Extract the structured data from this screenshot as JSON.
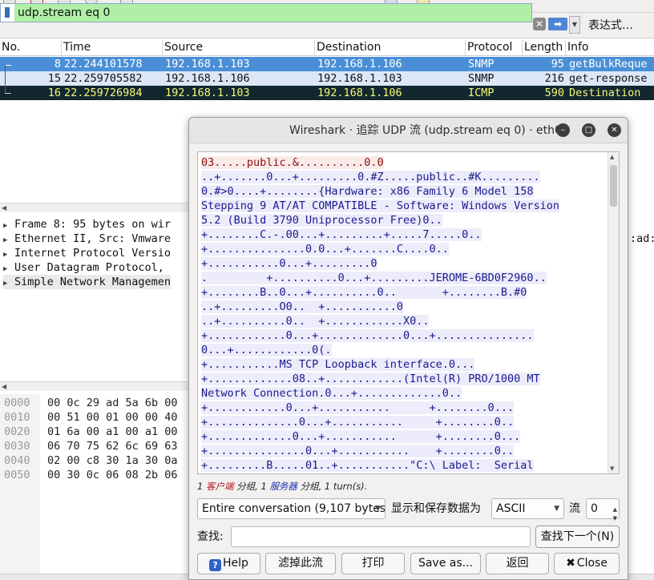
{
  "filter": {
    "value": "udp.stream eq 0",
    "expression_label": "表达式…"
  },
  "packet_list": {
    "columns": [
      "No.",
      "Time",
      "Source",
      "Destination",
      "Protocol",
      "Length",
      "Info"
    ],
    "rows": [
      {
        "no": "8",
        "time": "22.244101578",
        "source": "192.168.1.103",
        "destination": "192.168.1.106",
        "protocol": "SNMP",
        "length": "95",
        "info": "getBulkReque"
      },
      {
        "no": "15",
        "time": "22.259705582",
        "source": "192.168.1.106",
        "destination": "192.168.1.103",
        "protocol": "SNMP",
        "length": "216",
        "info": "get-response"
      },
      {
        "no": "16",
        "time": "22.259726984",
        "source": "192.168.1.103",
        "destination": "192.168.1.106",
        "protocol": "ICMP",
        "length": "590",
        "info": "Destination"
      }
    ]
  },
  "details": {
    "rows": [
      "Frame 8: 95 bytes on wir",
      "Ethernet II, Src: Vmware",
      "Internet Protocol Versio",
      "User Datagram Protocol,",
      "Simple Network Managemen"
    ],
    "right_fragment": ":ad:"
  },
  "bytes": {
    "rows": [
      {
        "offset": "0000",
        "hex": "00 0c 29 ad 5a 6b 00"
      },
      {
        "offset": "0010",
        "hex": "00 51 00 01 00 00 40"
      },
      {
        "offset": "0020",
        "hex": "01 6a 00 a1 00 a1 00"
      },
      {
        "offset": "0030",
        "hex": "06 70 75 62 6c 69 63"
      },
      {
        "offset": "0040",
        "hex": "02 00 c8 30 1a 30 0a"
      },
      {
        "offset": "0050",
        "hex": "00 30 0c 06 08 2b 06"
      }
    ]
  },
  "dialog": {
    "title": "Wireshark · 追踪 UDP 流 (udp.stream eq 0) · eth0",
    "stream_lines": [
      {
        "who": "client",
        "text": "03.....public.&..........0.0"
      },
      {
        "who": "server",
        "text": "..+.......0...+.........0.#Z.....public..#K........."
      },
      {
        "who": "server",
        "text": "0.#>0....+........{Hardware: x86 Family 6 Model 158"
      },
      {
        "who": "server",
        "text": "Stepping 9 AT/AT COMPATIBLE - Software: Windows Version"
      },
      {
        "who": "server",
        "text": "5.2 (Build 3790 Uniprocessor Free)0.."
      },
      {
        "who": "server",
        "text": "+........C.-.00...+.........+.....7.....0.."
      },
      {
        "who": "server",
        "text": "+...............0.0...+.......C....0.."
      },
      {
        "who": "server",
        "text": "+...........0...+.........0"
      },
      {
        "who": "server",
        "text": ".         +..........0...+.........JEROME-6BD0F2960.."
      },
      {
        "who": "server",
        "text": "+........B..0...+..........0..       +........B.#0"
      },
      {
        "who": "server",
        "text": "..+.........O0..  +...........0"
      },
      {
        "who": "server",
        "text": "..+..........0..  +............X0.."
      },
      {
        "who": "server",
        "text": "+............0...+.............0...+..............."
      },
      {
        "who": "server",
        "text": "0...+............0(."
      },
      {
        "who": "server",
        "text": "+...........MS TCP Loopback interface.0..."
      },
      {
        "who": "server",
        "text": "+.............08..+............(Intel(R) PRO/1000 MT"
      },
      {
        "who": "server",
        "text": "Network Connection.0...+.............0.."
      },
      {
        "who": "server",
        "text": "+............0...+...........      +........0..."
      },
      {
        "who": "server",
        "text": "+..............0...+...........     +........0.."
      },
      {
        "who": "server",
        "text": "+.............0...+...........      +........0..."
      },
      {
        "who": "server",
        "text": "+...............0...+...........    +........0.."
      },
      {
        "who": "server",
        "text": "+.........B.....01..+...........\"C:\\ Label:  Serial"
      }
    ],
    "stats": {
      "client_count": "1",
      "client_label": "客户端",
      "t1": "分组,",
      "server_count": "1",
      "server_label": "服务器",
      "t2": "分组,",
      "turns": "1 turn(s)."
    },
    "conversation_select": "Entire conversation (9,107 bytes)",
    "show_label": "显示和保存数据为",
    "format_select": "ASCII",
    "stream_label": "流",
    "stream_number": "0",
    "find_label": "查找:",
    "find_value": "",
    "find_next_label": "查找下一个(N)",
    "buttons": {
      "help": "Help",
      "filter_out": "滤掉此流",
      "print": "打印",
      "save_as": "Save as...",
      "back": "返回",
      "close": "Close"
    }
  },
  "colors": {
    "filter_bg": "#aff0a6",
    "selected_row": "#4a8fd6",
    "icmp_row_bg": "#12272e",
    "icmp_row_fg": "#f7f77a",
    "client_text": "#8a1010",
    "server_text": "#1a1a8f"
  }
}
